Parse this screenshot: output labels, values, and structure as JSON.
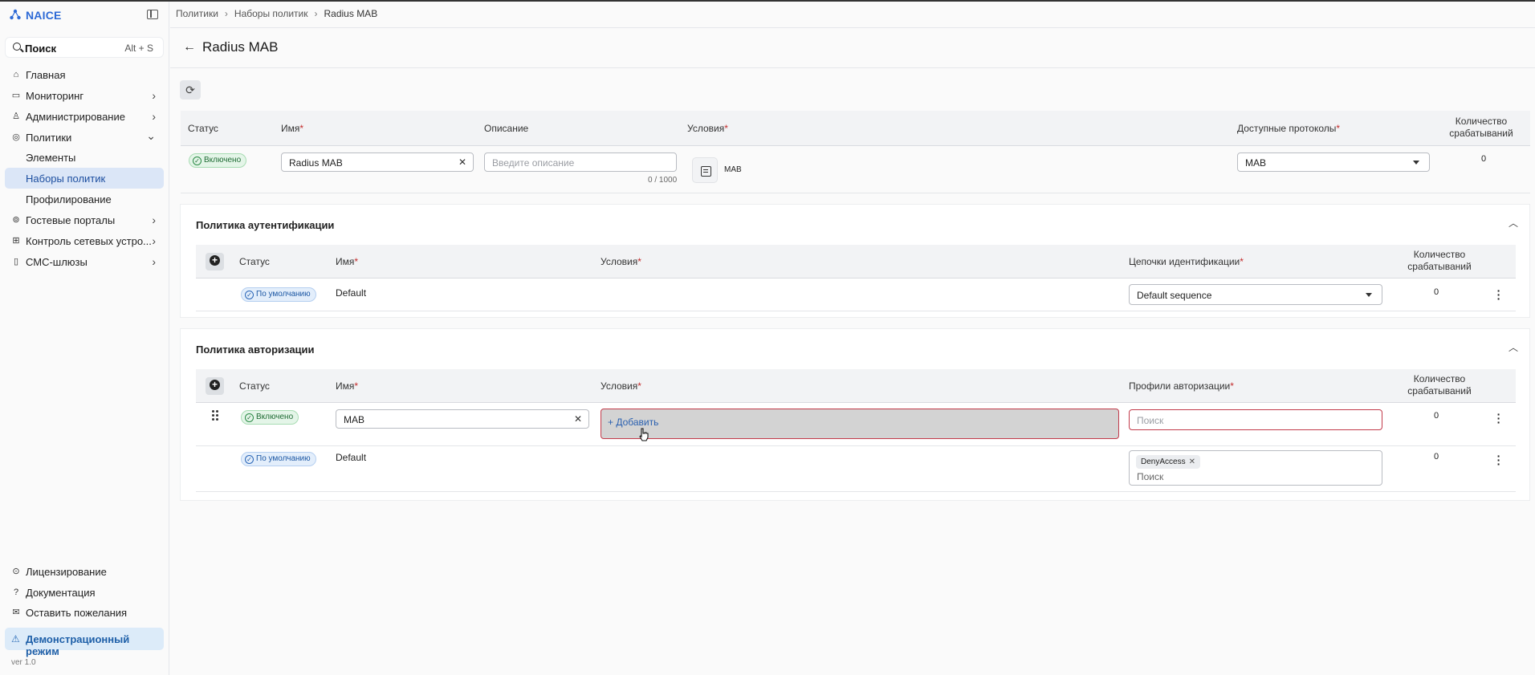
{
  "app": {
    "name": "NAICE",
    "version": "ver 1.0"
  },
  "search": {
    "label": "Поиск",
    "shortcut": "Alt + S"
  },
  "sidebar": {
    "items": [
      {
        "label": "Главная"
      },
      {
        "label": "Мониторинг"
      },
      {
        "label": "Администрирование"
      },
      {
        "label": "Политики"
      },
      {
        "label": "Элементы"
      },
      {
        "label": "Наборы политик"
      },
      {
        "label": "Профилирование"
      },
      {
        "label": "Гостевые порталы"
      },
      {
        "label": "Контроль сетевых устро..."
      },
      {
        "label": "СМС-шлюзы"
      }
    ],
    "bottom": [
      {
        "label": "Лицензирование"
      },
      {
        "label": "Документация"
      },
      {
        "label": "Оставить пожелания"
      }
    ],
    "demo": "Демонстрационный режим"
  },
  "breadcrumb": [
    "Политики",
    "Наборы политик",
    "Radius MAB"
  ],
  "page": {
    "title": "Radius MAB"
  },
  "policy_set": {
    "columns": {
      "status": "Статус",
      "name": "Имя",
      "description": "Описание",
      "conditions": "Условия",
      "protocols": "Доступные протоколы",
      "hits": "Количество срабатываний"
    },
    "row": {
      "status": "Включено",
      "name": "Radius MAB",
      "description_placeholder": "Введите описание",
      "counter": "0 / 1000",
      "condition": "MAB",
      "protocol": "MAB",
      "hits": "0"
    }
  },
  "auth_policy": {
    "title": "Политика аутентификации",
    "columns": {
      "status": "Статус",
      "name": "Имя",
      "conditions": "Условия",
      "chains": "Цепочки идентификации",
      "hits": "Количество срабатываний"
    },
    "rows": [
      {
        "status": "По умолчанию",
        "name": "Default",
        "chain": "Default sequence",
        "hits": "0"
      }
    ]
  },
  "authz_policy": {
    "title": "Политика авторизации",
    "columns": {
      "status": "Статус",
      "name": "Имя",
      "conditions": "Условия",
      "profiles": "Профили авторизации",
      "hits": "Количество срабатываний"
    },
    "rows": [
      {
        "status": "Включено",
        "name": "MAB",
        "add_label": "Добавить",
        "search_placeholder": "Поиск",
        "hits": "0"
      },
      {
        "status": "По умолчанию",
        "name": "Default",
        "tag": "DenyAccess",
        "search_placeholder": "Поиск",
        "hits": "0"
      }
    ]
  },
  "colors": {
    "accent": "#2d6ad6",
    "active_nav": "#dbe6f7",
    "error": "#c23a4a",
    "enabled": "#2a8a45"
  }
}
